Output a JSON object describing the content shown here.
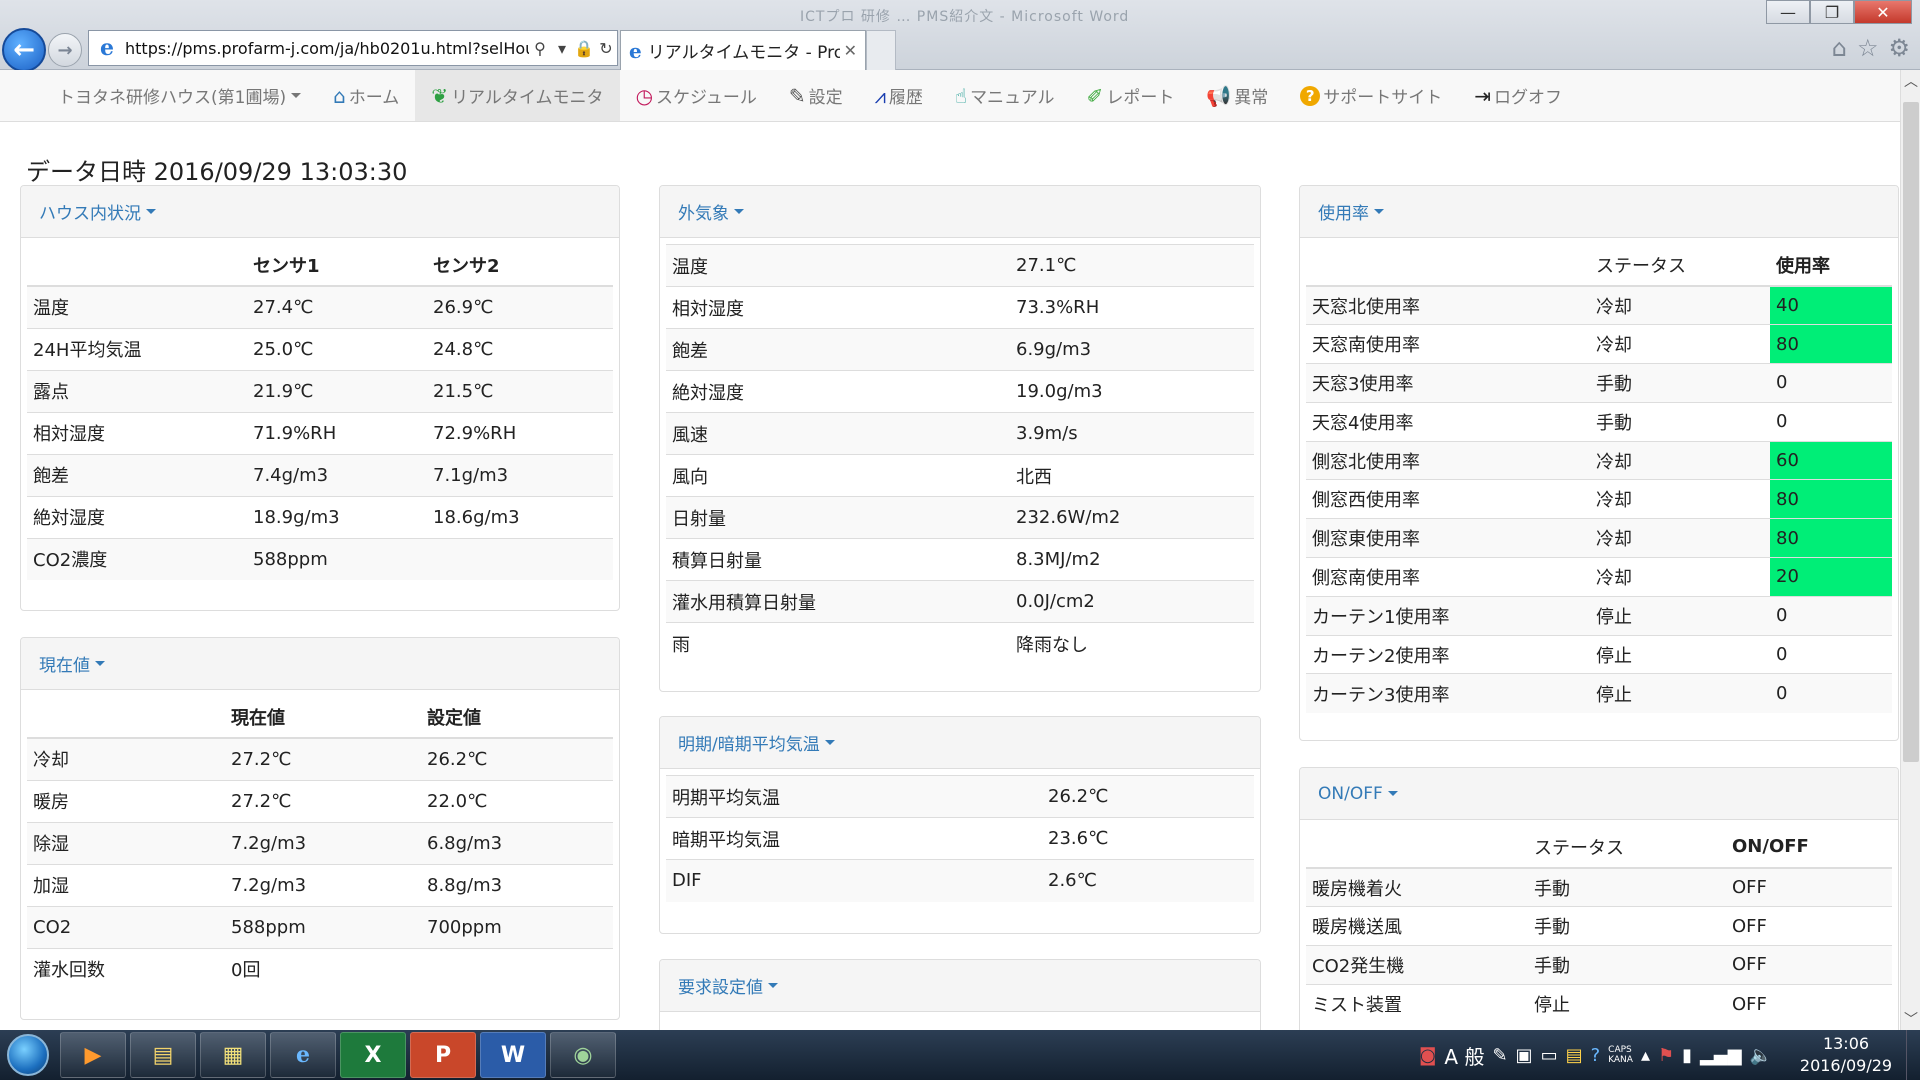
{
  "browser": {
    "faded_title": "ICTプロ 研修 … PMS紹介文 - Microsoft Word",
    "url": "https://pms.profarm-j.com/ja/hb0201u.html?selHous",
    "tab_title": "リアルタイムモニタ - Pro...",
    "min_label": "—",
    "max_label": "❐",
    "close_label": "✕"
  },
  "nav": {
    "house_select": "トヨタネ研修ハウス(第1圃場)",
    "items": [
      {
        "label": "ホーム",
        "icon": "⌂"
      },
      {
        "label": "リアルタイムモニタ",
        "icon": "❦"
      },
      {
        "label": "スケジュール",
        "icon": "◷"
      },
      {
        "label": "設定",
        "icon": "✎"
      },
      {
        "label": "履歴",
        "icon": "⩘"
      },
      {
        "label": "マニュアル",
        "icon": "☝"
      },
      {
        "label": "レポート",
        "icon": "✐"
      },
      {
        "label": "異常",
        "icon": "📢"
      },
      {
        "label": "サポートサイト",
        "icon": "?"
      },
      {
        "label": "ログオフ",
        "icon": "⇥"
      }
    ]
  },
  "datetime_label": "データ日時 2016/09/29 13:03:30",
  "house": {
    "title": "ハウス内状況",
    "headers": [
      "",
      "センサ1",
      "センサ2"
    ],
    "rows": [
      [
        "温度",
        "27.4℃",
        "26.9℃"
      ],
      [
        "24H平均気温",
        "25.0℃",
        "24.8℃"
      ],
      [
        "露点",
        "21.9℃",
        "21.5℃"
      ],
      [
        "相対湿度",
        "71.9%RH",
        "72.9%RH"
      ],
      [
        "飽差",
        "7.4g/m3",
        "7.1g/m3"
      ],
      [
        "絶対湿度",
        "18.9g/m3",
        "18.6g/m3"
      ],
      [
        "CO2濃度",
        "588ppm",
        ""
      ]
    ]
  },
  "current": {
    "title": "現在値",
    "headers": [
      "",
      "現在値",
      "設定値"
    ],
    "rows": [
      [
        "冷却",
        "27.2℃",
        "26.2℃"
      ],
      [
        "暖房",
        "27.2℃",
        "22.0℃"
      ],
      [
        "除湿",
        "7.2g/m3",
        "6.8g/m3"
      ],
      [
        "加湿",
        "7.2g/m3",
        "8.8g/m3"
      ],
      [
        "CO2",
        "588ppm",
        "700ppm"
      ],
      [
        "灌水回数",
        "0回",
        ""
      ]
    ]
  },
  "weather": {
    "title": "外気象",
    "rows": [
      [
        "温度",
        "27.1℃"
      ],
      [
        "相対湿度",
        "73.3%RH"
      ],
      [
        "飽差",
        "6.9g/m3"
      ],
      [
        "絶対湿度",
        "19.0g/m3"
      ],
      [
        "風速",
        "3.9m/s"
      ],
      [
        "風向",
        "北西"
      ],
      [
        "日射量",
        "232.6W/m2"
      ],
      [
        "積算日射量",
        "8.3MJ/m2"
      ],
      [
        "灌水用積算日射量",
        "0.0J/cm2"
      ],
      [
        "雨",
        "降雨なし"
      ]
    ]
  },
  "lightdark": {
    "title": "明期/暗期平均気温",
    "rows": [
      [
        "明期平均気温",
        "26.2℃"
      ],
      [
        "暗期平均気温",
        "23.6℃"
      ],
      [
        "DIF",
        "2.6℃"
      ]
    ]
  },
  "request": {
    "title": "要求設定値"
  },
  "usage": {
    "title": "使用率",
    "headers": [
      "",
      "ステータス",
      "使用率"
    ],
    "highlight_color": "#00ee77",
    "rows": [
      [
        "天窓北使用率",
        "冷却",
        "40"
      ],
      [
        "天窓南使用率",
        "冷却",
        "80"
      ],
      [
        "天窓3使用率",
        "手動",
        "0"
      ],
      [
        "天窓4使用率",
        "手動",
        "0"
      ],
      [
        "側窓北使用率",
        "冷却",
        "60"
      ],
      [
        "側窓西使用率",
        "冷却",
        "80"
      ],
      [
        "側窓東使用率",
        "冷却",
        "80"
      ],
      [
        "側窓南使用率",
        "冷却",
        "20"
      ],
      [
        "カーテン1使用率",
        "停止",
        "0"
      ],
      [
        "カーテン2使用率",
        "停止",
        "0"
      ],
      [
        "カーテン3使用率",
        "停止",
        "0"
      ]
    ]
  },
  "onoff": {
    "title": "ON/OFF",
    "headers": [
      "",
      "ステータス",
      "ON/OFF"
    ],
    "rows": [
      [
        "暖房機着火",
        "手動",
        "OFF"
      ],
      [
        "暖房機送風",
        "手動",
        "OFF"
      ],
      [
        "CO2発生機",
        "手動",
        "OFF"
      ],
      [
        "ミスト装置",
        "停止",
        "OFF"
      ]
    ]
  },
  "taskbar": {
    "apps": [
      "▶",
      "▤",
      "▦",
      "e",
      "X",
      "P",
      "W",
      "◉"
    ],
    "ime": "A 般",
    "caps": "CAPS",
    "kana": "KANA",
    "time": "13:06",
    "date": "2016/09/29"
  }
}
